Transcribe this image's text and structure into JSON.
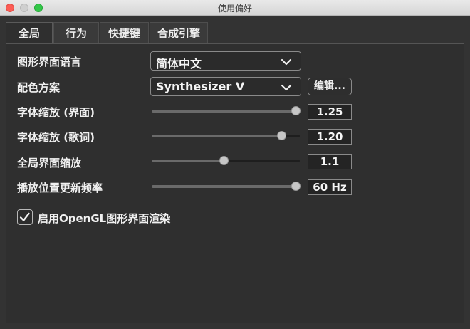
{
  "window": {
    "title": "使用偏好"
  },
  "tabs": [
    {
      "label": "全局",
      "active": true
    },
    {
      "label": "行为",
      "active": false
    },
    {
      "label": "快捷键",
      "active": false
    },
    {
      "label": "合成引擎",
      "active": false
    }
  ],
  "settings": {
    "language": {
      "label": "图形界面语言",
      "value": "简体中文"
    },
    "color_scheme": {
      "label": "配色方案",
      "value": "Synthesizer V",
      "edit_label": "编辑..."
    },
    "font_scale_ui": {
      "label": "字体缩放 (界面)",
      "value": "1.25",
      "level": 1.0
    },
    "font_scale_lyrics": {
      "label": "字体缩放 (歌词)",
      "value": "1.20",
      "level": 0.9
    },
    "global_scale": {
      "label": "全局界面缩放",
      "value": "1.1",
      "level": 0.5
    },
    "playback_refresh": {
      "label": "播放位置更新频率",
      "value": "60 Hz",
      "level": 1.0
    },
    "opengl": {
      "label": "启用OpenGL图形界面渲染",
      "checked": true
    }
  },
  "colors": {
    "background": "#333333",
    "panel": "#2f2f2f",
    "knob": "#c6c6c6"
  },
  "icons": {
    "combo_arrow": "chevron-down-icon",
    "checkbox": "checkmark-icon"
  }
}
